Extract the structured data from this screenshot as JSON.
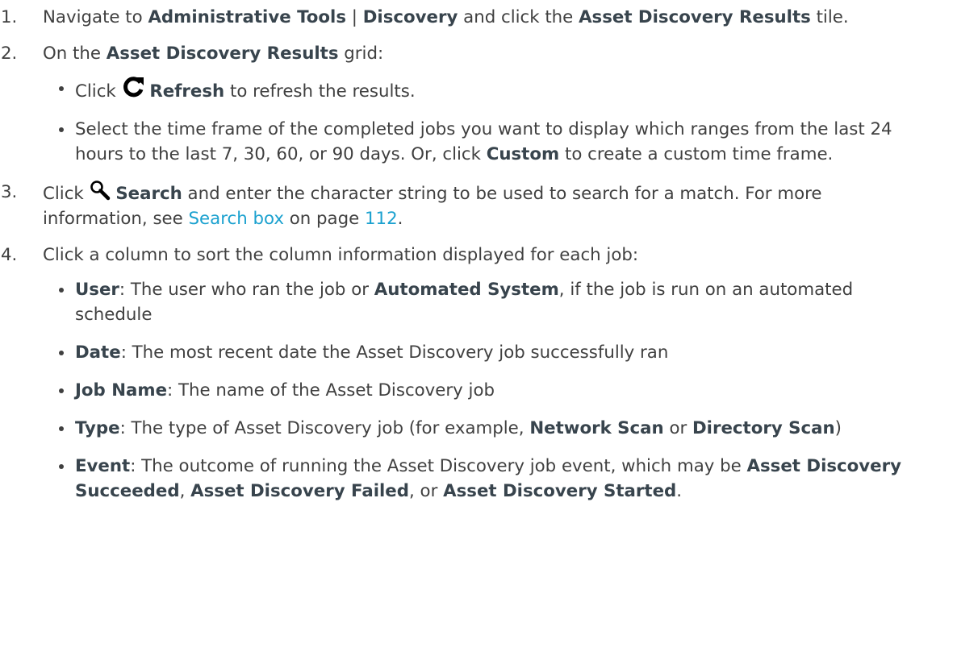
{
  "steps": [
    {
      "num": "1.",
      "parts": [
        {
          "t": "Navigate to ",
          "b": false
        },
        {
          "t": "Administrative Tools",
          "b": true
        },
        {
          "t": " | ",
          "b": false
        },
        {
          "t": "Discovery",
          "b": true
        },
        {
          "t": " and click the ",
          "b": false
        },
        {
          "t": "Asset Discovery Results",
          "b": true
        },
        {
          "t": " tile.",
          "b": false
        }
      ]
    },
    {
      "num": "2.",
      "parts": [
        {
          "t": "On the ",
          "b": false
        },
        {
          "t": "Asset Discovery Results",
          "b": true
        },
        {
          "t": " grid:",
          "b": false
        }
      ],
      "bullets": [
        {
          "refresh_prefix": "Click ",
          "refresh_label": "Refresh",
          "refresh_suffix": " to refresh the results.",
          "icon": "refresh-icon"
        },
        {
          "parts": [
            {
              "t": "Select the time frame of the completed jobs you want to display which ranges from the last 24 hours to the last 7, 30, 60, or 90 days. Or, click ",
              "b": false
            },
            {
              "t": "Custom",
              "b": true
            },
            {
              "t": " to create a custom time frame.",
              "b": false
            }
          ]
        }
      ]
    },
    {
      "num": "3.",
      "search_prefix": "Click ",
      "search_label": "Search",
      "search_middle": " and enter the character string to be used to search for a match. For more information, see ",
      "link_text": "Search box",
      "link_mid": " on page ",
      "page_number": "112",
      "link_end": ".",
      "icon": "search-icon"
    },
    {
      "num": "4.",
      "parts": [
        {
          "t": "Click a column to sort the column information displayed for each job:",
          "b": false
        }
      ],
      "bullets": [
        {
          "parts": [
            {
              "t": "User",
              "b": true
            },
            {
              "t": ": The user who ran the job or ",
              "b": false
            },
            {
              "t": "Automated System",
              "b": true
            },
            {
              "t": ", if the job is run on an automated schedule",
              "b": false
            }
          ]
        },
        {
          "parts": [
            {
              "t": "Date",
              "b": true
            },
            {
              "t": ": The most recent date the Asset Discovery job successfully ran",
              "b": false
            }
          ]
        },
        {
          "parts": [
            {
              "t": "Job Name",
              "b": true
            },
            {
              "t": ": The name of the Asset Discovery job",
              "b": false
            }
          ]
        },
        {
          "parts": [
            {
              "t": "Type",
              "b": true
            },
            {
              "t": ": The type of Asset Discovery job (for example, ",
              "b": false
            },
            {
              "t": "Network Scan",
              "b": true
            },
            {
              "t": " or ",
              "b": false
            },
            {
              "t": "Directory Scan",
              "b": true
            },
            {
              "t": ")",
              "b": false
            }
          ]
        },
        {
          "parts": [
            {
              "t": "Event",
              "b": true
            },
            {
              "t": ": The outcome of running the Asset Discovery job event, which may be ",
              "b": false
            },
            {
              "t": "Asset Discovery Succeeded",
              "b": true
            },
            {
              "t": ", ",
              "b": false
            },
            {
              "t": "Asset Discovery Failed",
              "b": true
            },
            {
              "t": ", or ",
              "b": false
            },
            {
              "t": "Asset Discovery Started",
              "b": true
            },
            {
              "t": ".",
              "b": false
            }
          ]
        }
      ]
    }
  ],
  "colors": {
    "body_text": "#404040",
    "bold_text": "#38444d",
    "link": "#1ba1cf"
  }
}
